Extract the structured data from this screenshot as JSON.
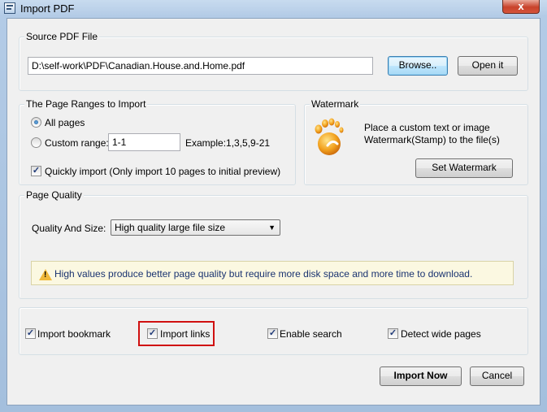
{
  "window": {
    "title": "Import PDF",
    "close_label": "x"
  },
  "source": {
    "group_label": "Source PDF File",
    "path_value": "D:\\self-work\\PDF\\Canadian.House.and.Home.pdf",
    "browse_label": "Browse..",
    "open_label": "Open it"
  },
  "ranges": {
    "group_label": "The Page Ranges to Import",
    "all_pages_label": "All pages",
    "all_pages_selected": true,
    "custom_range_label": "Custom range:",
    "custom_range_value": "1-1",
    "example_label": "Example:1,3,5,9-21",
    "quick_import_label": "Quickly import (Only import 10 pages to  initial  preview)",
    "quick_import_checked": true
  },
  "watermark": {
    "group_label": "Watermark",
    "desc_line1": "Place a custom text or image",
    "desc_line2": "Watermark(Stamp) to the file(s)",
    "button_label": "Set Watermark",
    "icon": "footprint-icon"
  },
  "quality": {
    "group_label": "Page Quality",
    "field_label": "Quality And Size:",
    "selected_option": "High quality large file size",
    "warning_text": "High values produce better page quality but require more disk space and more time to download."
  },
  "options": {
    "import_bookmark": {
      "label": "Import bookmark",
      "checked": true
    },
    "import_links": {
      "label": "Import links",
      "checked": true
    },
    "enable_search": {
      "label": "Enable search",
      "checked": true
    },
    "detect_wide_pages": {
      "label": "Detect wide pages",
      "checked": true
    }
  },
  "footer": {
    "import_now_label": "Import Now",
    "cancel_label": "Cancel"
  },
  "colors": {
    "highlight": "#d01010",
    "warning_text": "#1a3370",
    "warning_bg": "#fbf8e1"
  }
}
